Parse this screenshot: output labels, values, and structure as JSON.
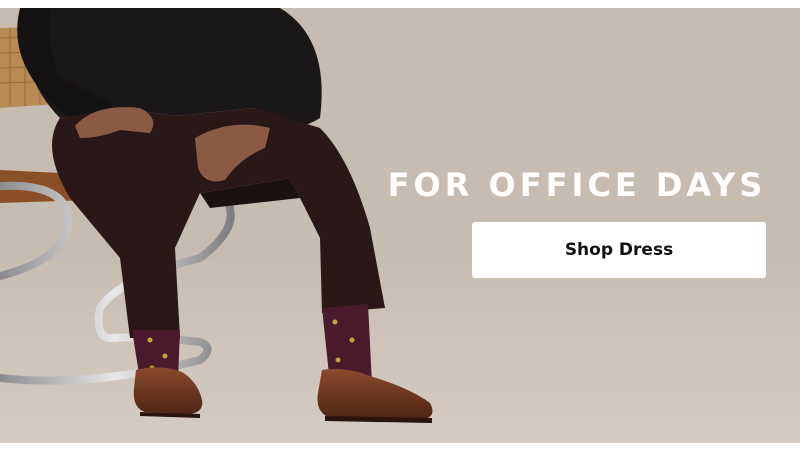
{
  "banner": {
    "headline": "FOR OFFICE DAYS",
    "cta_label": "Shop Dress"
  },
  "photo": {
    "subject": "seated-man-dress-outfit",
    "colors": {
      "backdrop": "#c6bbb0",
      "sweater": "#1a1718",
      "trousers": "#2a1819",
      "socks": "#4a1a2c",
      "loafers": "#6a3420",
      "chair_chrome": "#b8b8bc",
      "chair_cane": "#b88a54"
    }
  }
}
